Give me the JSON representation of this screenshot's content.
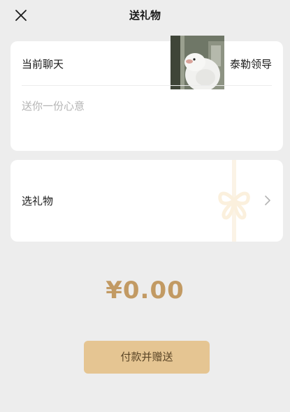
{
  "header": {
    "title": "送礼物",
    "close_icon": "close-icon"
  },
  "recipient": {
    "label": "当前聊天",
    "name": "泰勒领导",
    "avatar_icon": "white-bird-avatar"
  },
  "message": {
    "placeholder": "送你一份心意",
    "value": ""
  },
  "gift": {
    "label": "选礼物",
    "decoration_icon": "ribbon-bow-icon",
    "chevron_icon": "chevron-right-icon"
  },
  "amount": {
    "display": "¥0.00"
  },
  "pay_button": {
    "label": "付款并赠送"
  },
  "colors": {
    "accent": "#c29a63",
    "button_bg": "#e5c592",
    "page_bg": "#ededed"
  }
}
